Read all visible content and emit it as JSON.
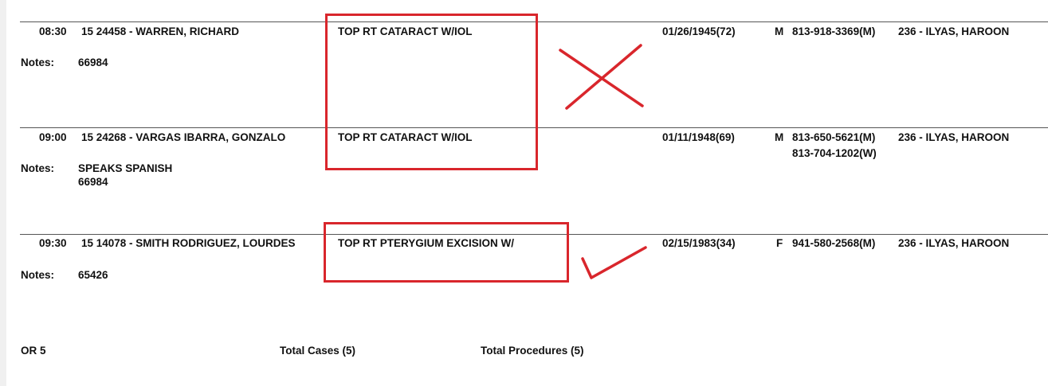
{
  "appointments": [
    {
      "time": "08:30",
      "patient": "15 24458 - WARREN, RICHARD",
      "procedure": "TOP  RT CATARACT W/IOL",
      "dob": "01/26/1945(72)",
      "sex": "M",
      "phones": [
        "813-918-3369(M)"
      ],
      "provider": "236 - ILYAS, HAROON",
      "notes_label": "Notes:",
      "notes": [
        "66984"
      ]
    },
    {
      "time": "09:00",
      "patient": "15 24268 - VARGAS IBARRA, GONZALO",
      "procedure": "TOP  RT CATARACT W/IOL",
      "dob": "01/11/1948(69)",
      "sex": "M",
      "phones": [
        "813-650-5621(M)",
        "813-704-1202(W)"
      ],
      "provider": "236 - ILYAS, HAROON",
      "notes_label": "Notes:",
      "notes": [
        "SPEAKS SPANISH",
        "66984"
      ]
    },
    {
      "time": "09:30",
      "patient": "15 14078 - SMITH RODRIGUEZ, LOURDES",
      "procedure": "TOP  RT PTERYGIUM EXCISION W/",
      "dob": "02/15/1983(34)",
      "sex": "F",
      "phones": [
        "941-580-2568(M)"
      ],
      "provider": "236 - ILYAS, HAROON",
      "notes_label": "Notes:",
      "notes": [
        "65426"
      ]
    }
  ],
  "footer": {
    "room": "OR 5",
    "total_cases": "Total Cases (5)",
    "total_procedures": "Total Procedures (5)"
  },
  "annotations": {
    "color": "#d9262c",
    "marks": [
      "x-mark",
      "check-mark"
    ]
  }
}
